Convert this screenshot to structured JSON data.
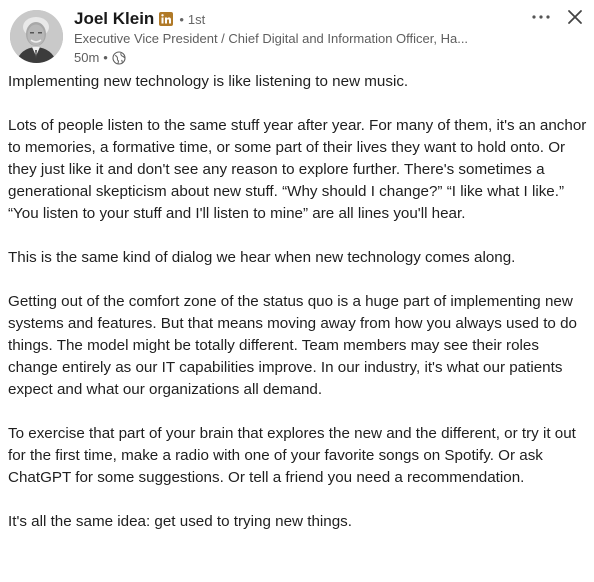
{
  "author": {
    "name": "Joel Klein",
    "badge_icon": "linkedin-premium-icon",
    "separator": "•",
    "degree": "1st",
    "headline": "Executive Vice President / Chief Digital and Information Officer, Ha...",
    "time": "50m",
    "time_separator": "•",
    "visibility_icon": "globe-icon"
  },
  "actions": {
    "more_icon": "more-horizontal-icon",
    "close_icon": "close-icon"
  },
  "post": {
    "paragraphs": [
      "Implementing new technology is like listening to new music.",
      "Lots of people listen to the same stuff year after year. For many of them, it's an anchor to memories, a formative time, or some part of their lives they want to hold onto. Or they just like it and don't see any reason to explore further. There's sometimes a generational skepticism about new stuff. “Why should I change?” “I like what I like.” “You listen to your stuff and I'll listen to mine” are all lines you'll hear.",
      "This is the same kind of dialog we hear when new technology comes along.",
      "Getting out of the comfort zone of the status quo is a huge part of implementing new systems and features. But that means moving away from how you always used to do things. The model might be totally different. Team members may see their roles change entirely as our IT capabilities improve. In our industry, it's what our patients expect and what our organizations all demand.",
      "To exercise that part of your brain that explores the new and the different, or try it out for the first time, make a radio with one of your favorite songs on Spotify. Or ask ChatGPT for some suggestions. Or tell a friend you need a recommendation.",
      "It's all the same idea: get used to trying new things."
    ]
  },
  "colors": {
    "badge": "#b07a28",
    "text": "#1f1f1f",
    "muted": "#5e5e5e"
  }
}
